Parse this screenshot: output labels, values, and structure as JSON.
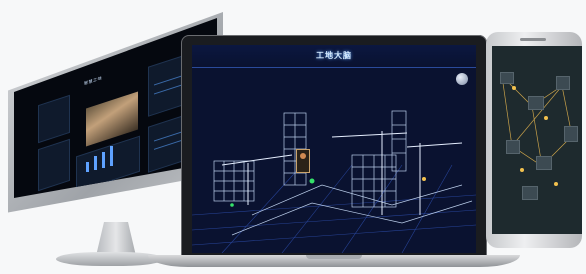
{
  "monitor": {
    "dashboard_title": "智慧工地",
    "panels": 6
  },
  "laptop": {
    "header_title": "工地大脑",
    "banner_text": "",
    "left_stats": [
      "",
      ""
    ],
    "right_stats": [
      "",
      ""
    ],
    "accent_color": "#5aa0ff",
    "background_color": "#0a1230",
    "icons": [
      "globe-icon",
      "person-card"
    ]
  },
  "phone": {
    "screen_color": "#1e2a2e",
    "pin_color": "#f2c14e"
  },
  "colors": {
    "page_background": "#f7f8f9",
    "wireframe": "#cfe3ff",
    "highlight_green": "#35e26a",
    "highlight_yellow": "#f2c14e"
  }
}
